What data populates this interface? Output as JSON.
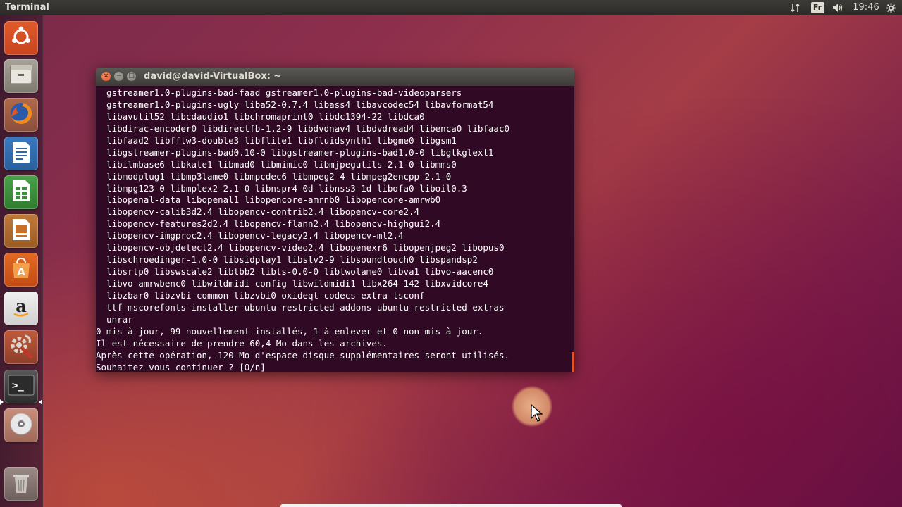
{
  "top_panel": {
    "app_title": "Terminal",
    "keyboard_layout": "Fr",
    "clock": "19:46",
    "icons": [
      "network-icon",
      "keyboard-layout-icon",
      "sound-icon",
      "settings-icon"
    ]
  },
  "launcher": {
    "items": [
      {
        "name": "dash",
        "icon": "ubuntu-logo-icon"
      },
      {
        "name": "files",
        "icon": "files-icon"
      },
      {
        "name": "firefox",
        "icon": "firefox-icon"
      },
      {
        "name": "writer",
        "icon": "writer-icon"
      },
      {
        "name": "calc",
        "icon": "calc-icon"
      },
      {
        "name": "impress",
        "icon": "impress-icon"
      },
      {
        "name": "software-center",
        "icon": "software-center-icon",
        "label": "A"
      },
      {
        "name": "amazon",
        "icon": "amazon-icon",
        "label": "a"
      },
      {
        "name": "system-settings",
        "icon": "system-settings-icon"
      },
      {
        "name": "terminal",
        "icon": "terminal-icon",
        "label": ">_"
      },
      {
        "name": "dvd",
        "icon": "dvd-icon"
      },
      {
        "name": "trash",
        "icon": "trash-icon"
      }
    ]
  },
  "terminal": {
    "window_title": "david@david-VirtualBox: ~",
    "lines": [
      "  gstreamer1.0-plugins-bad-faad gstreamer1.0-plugins-bad-videoparsers",
      "  gstreamer1.0-plugins-ugly liba52-0.7.4 libass4 libavcodec54 libavformat54",
      "  libavutil52 libcdaudio1 libchromaprint0 libdc1394-22 libdca0",
      "  libdirac-encoder0 libdirectfb-1.2-9 libdvdnav4 libdvdread4 libenca0 libfaac0",
      "  libfaad2 libfftw3-double3 libflite1 libfluidsynth1 libgme0 libgsm1",
      "  libgstreamer-plugins-bad0.10-0 libgstreamer-plugins-bad1.0-0 libgtkglext1",
      "  libilmbase6 libkate1 libmad0 libmimic0 libmjpegutils-2.1-0 libmms0",
      "  libmodplug1 libmp3lame0 libmpcdec6 libmpeg2-4 libmpeg2encpp-2.1-0",
      "  libmpg123-0 libmplex2-2.1-0 libnspr4-0d libnss3-1d libofa0 liboil0.3",
      "  libopenal-data libopenal1 libopencore-amrnb0 libopencore-amrwb0",
      "  libopencv-calib3d2.4 libopencv-contrib2.4 libopencv-core2.4",
      "  libopencv-features2d2.4 libopencv-flann2.4 libopencv-highgui2.4",
      "  libopencv-imgproc2.4 libopencv-legacy2.4 libopencv-ml2.4",
      "  libopencv-objdetect2.4 libopencv-video2.4 libopenexr6 libopenjpeg2 libopus0",
      "  libschroedinger-1.0-0 libsidplay1 libslv2-9 libsoundtouch0 libspandsp2",
      "  libsrtp0 libswscale2 libtbb2 libts-0.0-0 libtwolame0 libva1 libvo-aacenc0",
      "  libvo-amrwbenc0 libwildmidi-config libwildmidi1 libx264-142 libxvidcore4",
      "  libzbar0 libzvbi-common libzvbi0 oxideqt-codecs-extra tsconf",
      "  ttf-mscorefonts-installer ubuntu-restricted-addons ubuntu-restricted-extras",
      "  unrar",
      "0 mis à jour, 99 nouvellement installés, 1 à enlever et 0 non mis à jour.",
      "Il est nécessaire de prendre 60,4 Mo dans les archives.",
      "Après cette opération, 120 Mo d'espace disque supplémentaires seront utilisés.",
      "Souhaitez-vous continuer ? [O/n] "
    ]
  },
  "colors": {
    "terminal_background": "#300a24",
    "terminal_text": "#ffffff",
    "accent": "#e2552a"
  }
}
